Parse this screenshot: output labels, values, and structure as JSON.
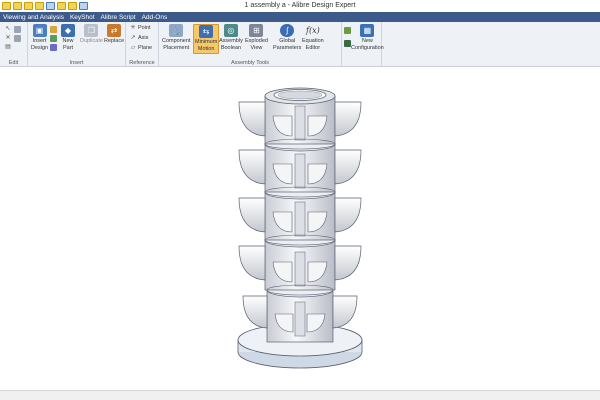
{
  "window": {
    "title": "1 assembly a - Alibre Design Expert"
  },
  "menu": {
    "items": [
      "Viewing and Analysis",
      "KeyShot",
      "Alibre Script",
      "Add-Ons"
    ]
  },
  "ribbon": {
    "groups": {
      "edit": "Edit",
      "insert": "Insert",
      "reference": "Reference",
      "assembly_tools": "Assembly Tools"
    },
    "buttons": {
      "insert_design": "Insert\nDesign",
      "new_part": "New\nPart",
      "duplicate": "Duplicate",
      "replace": "Replace",
      "point": "Point",
      "axis": "Axis",
      "plane": "Plane",
      "component_placement": "Component\nPlacement",
      "minimum_motion": "Minimum\nMotion",
      "assembly_boolean": "Assembly\nBoolean",
      "exploded_view": "Exploded\nView",
      "global_parameters": "Global\nParameters",
      "equation_editor": "Equation\nEditor",
      "new_configuration": "New\nConfiguration"
    },
    "icon_glyphs": {
      "equation_editor": "f(x)"
    }
  },
  "colors": {
    "menubar": "#3d5b8a",
    "active_tool": "#f6c86a",
    "model_fill": "#e8eaef",
    "model_edge": "#5a6070"
  }
}
